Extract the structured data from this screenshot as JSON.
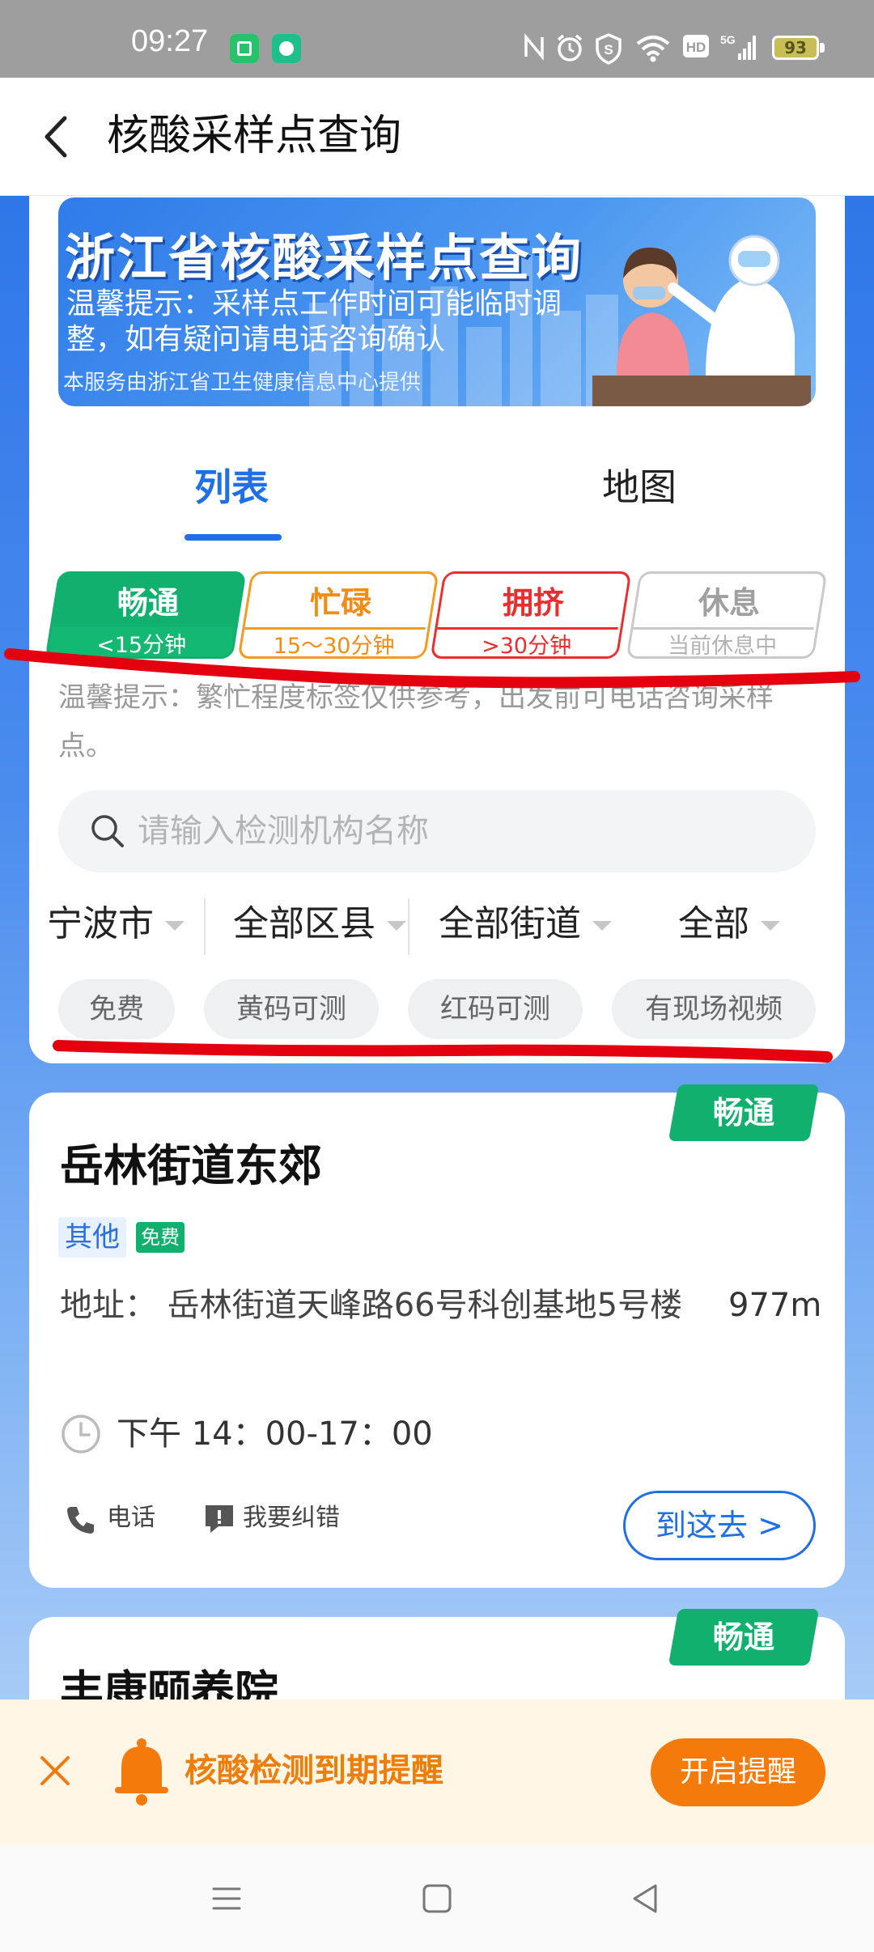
{
  "status_bar": {
    "time": "09:27",
    "battery": "93",
    "icons": [
      "nfc-icon",
      "alarm-icon",
      "shield-icon",
      "wifi-icon",
      "hd-icon",
      "signal-5g-icon",
      "battery-icon"
    ]
  },
  "header": {
    "title": "核酸采样点查询"
  },
  "banner": {
    "title": "浙江省核酸采样点查询",
    "tip": "温馨提示：采样点工作时间可能临时调整，如有疑问请电话咨询确认",
    "footer": "本服务由浙江省卫生健康信息中心提供"
  },
  "tabs": [
    {
      "label": "列表",
      "active": true
    },
    {
      "label": "地图",
      "active": false
    }
  ],
  "legend": [
    {
      "label": "畅通",
      "sub": "<15分钟",
      "color": "#12b06e"
    },
    {
      "label": "忙碌",
      "sub": "15～30分钟",
      "color": "#f59a1f"
    },
    {
      "label": "拥挤",
      "sub": ">30分钟",
      "color": "#ec2e2e"
    },
    {
      "label": "休息",
      "sub": "当前休息中",
      "color": "#c9c9c9"
    }
  ],
  "busy_tip": "温馨提示：繁忙程度标签仅供参考，出发前可电话咨询采样点。",
  "search": {
    "placeholder": "请输入检测机构名称"
  },
  "filters": [
    {
      "label": "宁波市"
    },
    {
      "label": "全部区县"
    },
    {
      "label": "全部街道"
    },
    {
      "label": "全部"
    }
  ],
  "chips": [
    "免费",
    "黄码可测",
    "红码可测",
    "有现场视频"
  ],
  "results": [
    {
      "status": "畅通",
      "name": "岳林街道东郊",
      "type": "其他",
      "free_tag": "免费",
      "address_label": "地址：",
      "address": "岳林街道天峰路66号科创基地5号楼",
      "distance": "977m",
      "hours": "下午 14：00-17：00",
      "phone_label": "电话",
      "report_label": "我要纠错",
      "go_label": "到这去 >"
    },
    {
      "status": "畅通",
      "name": "丰康颐养院"
    }
  ],
  "reminder": {
    "text": "核酸检测到期提醒",
    "button": "开启提醒"
  },
  "colors": {
    "primary_blue": "#1e6fe8",
    "green": "#12b06e",
    "orange": "#f57a0c",
    "annotation_red": "#e3000f"
  }
}
